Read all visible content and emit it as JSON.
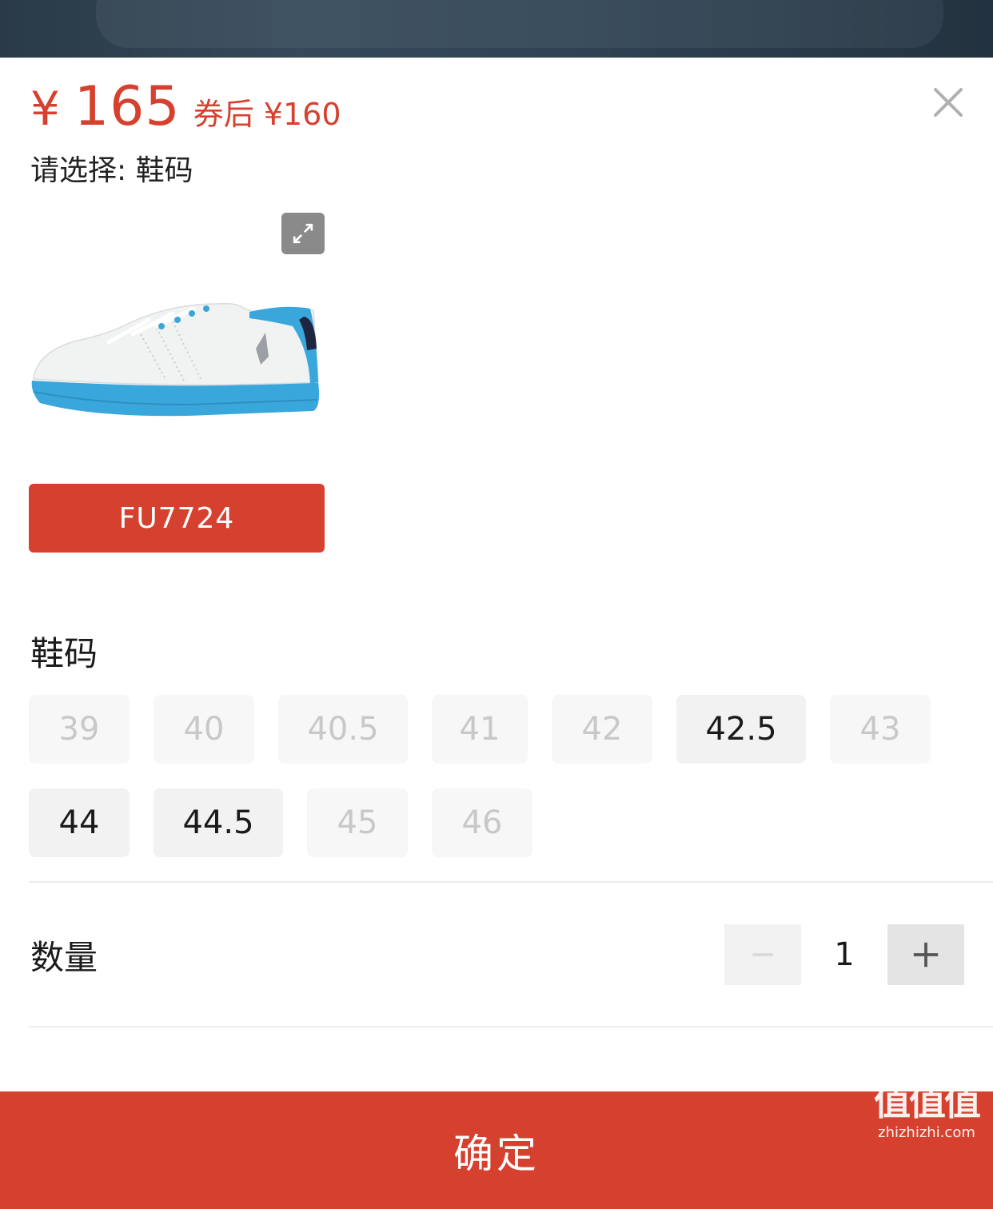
{
  "price": {
    "symbol": "¥",
    "amount": "165",
    "coupon_text": "券后 ¥160"
  },
  "select_hint": "请选择: 鞋码",
  "sku": {
    "label": "FU7724"
  },
  "size_section": {
    "title": "鞋码",
    "sizes": [
      {
        "label": "39",
        "available": false
      },
      {
        "label": "40",
        "available": false
      },
      {
        "label": "40.5",
        "available": false
      },
      {
        "label": "41",
        "available": false
      },
      {
        "label": "42",
        "available": false
      },
      {
        "label": "42.5",
        "available": true
      },
      {
        "label": "43",
        "available": false
      },
      {
        "label": "44",
        "available": true
      },
      {
        "label": "44.5",
        "available": true
      },
      {
        "label": "45",
        "available": false
      },
      {
        "label": "46",
        "available": false
      }
    ]
  },
  "quantity": {
    "label": "数量",
    "value": "1"
  },
  "confirm": {
    "label": "确定"
  },
  "watermark": {
    "cn": "值值值",
    "en": "zhizhizhi.com"
  },
  "icons": {
    "close": "close-icon",
    "expand": "expand-icon",
    "minus": "minus-icon",
    "plus": "plus-icon"
  },
  "colors": {
    "accent": "#d6412f",
    "chip_disabled_bg": "#f7f7f7",
    "chip_available_bg": "#f2f2f2"
  }
}
